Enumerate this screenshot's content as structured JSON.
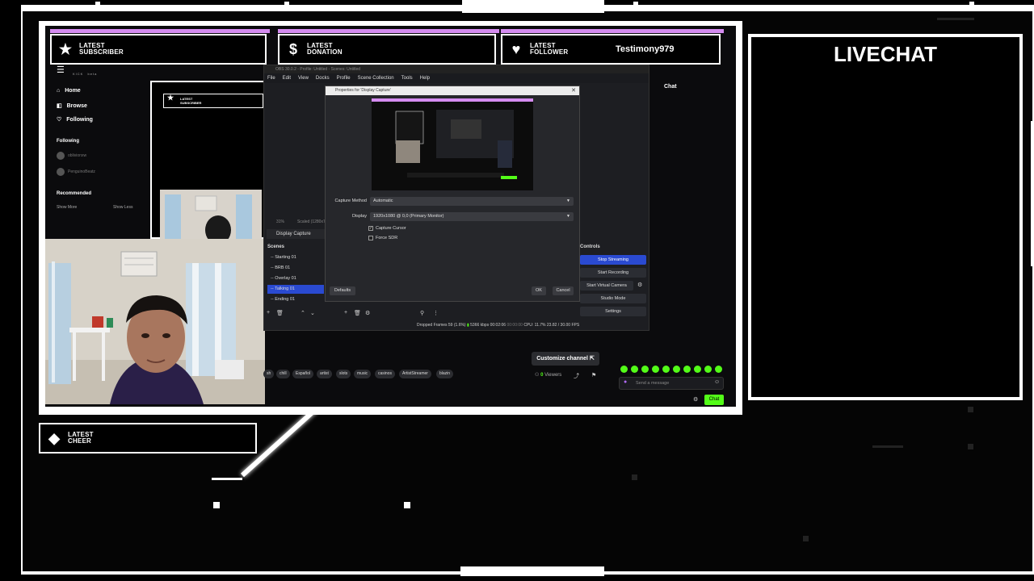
{
  "alerts": {
    "subscriber": {
      "label_line1": "LATEST",
      "label_line2": "SUBSCRIBER",
      "value": "",
      "icon": "star-icon",
      "glyph": "★"
    },
    "donation": {
      "label_line1": "LATEST",
      "label_line2": "DONATION",
      "value": "",
      "icon": "dollar-icon",
      "glyph": "$"
    },
    "follower": {
      "label_line1": "LATEST",
      "label_line2": "FOLLOWER",
      "value": "Testimony979",
      "icon": "heart-icon",
      "glyph": "♥"
    },
    "cheer": {
      "label_line1": "LATEST",
      "label_line2": "CHEER",
      "value": "",
      "icon": "diamond-icon",
      "glyph": "◆"
    }
  },
  "livechat": {
    "title": "LIVECHAT"
  },
  "kick": {
    "logo": "KICK",
    "logo_tag": "beta",
    "nav": {
      "home": "Home",
      "browse": "Browse",
      "following": "Following"
    },
    "sidebar": {
      "following_heading": "Following",
      "following_channels": [
        "oblivionxw",
        "PenguinoBeatz"
      ],
      "recommended_heading": "Recommended",
      "show_more": "Show More",
      "show_less": "Show Less"
    },
    "customize_channel": "Customize channel",
    "tags": [
      "sh",
      "chill",
      "Español",
      "artist",
      "slots",
      "music",
      "casinos",
      "ArtistStreamer",
      "blazin"
    ],
    "viewers_count": "0",
    "viewers_label": "Viewers",
    "chat_heading": "Chat",
    "chat_placeholder": "Send a message",
    "chat_button": "Chat"
  },
  "nested_preview": {
    "label_line1": "LATEST",
    "label_line2": "SUBSCRIBER"
  },
  "obs": {
    "window_title": "OBS 30.0.2 - Profile: Untitled - Scenes: Untitled",
    "menu": [
      "File",
      "Edit",
      "View",
      "Docks",
      "Profile",
      "Scene Collection",
      "Tools",
      "Help"
    ],
    "zoom": "31%",
    "scaled": "Scaled (1280x72...",
    "source": "Display Capture",
    "scenes_heading": "Scenes",
    "scenes": [
      "-- Starting 01",
      "-- BRB 01",
      "-- Overlay 01",
      "-- Talking 01",
      "-- Ending 01"
    ],
    "active_scene_index": 3,
    "controls_heading": "Controls",
    "controls": [
      "Stop Streaming",
      "Start Recording",
      "Start Virtual Camera",
      "Studio Mode",
      "Settings"
    ],
    "status": {
      "dropped_frames": "Dropped Frames 59 (1.6%)",
      "bitrate": "5366 kbps",
      "stream_time": "00:02:06",
      "rec_time": "00:00:00",
      "cpu": "CPU: 11.7%",
      "fps": "23.82 / 30.00 FPS"
    }
  },
  "dialog": {
    "title": "Properties for 'Display Capture'",
    "capture_method_label": "Capture Method",
    "capture_method_value": "Automatic",
    "display_label": "Display",
    "display_value": "1920x1080 @ 0,0 (Primary Monitor)",
    "capture_cursor": "Capture Cursor",
    "capture_cursor_checked": true,
    "force_sdr": "Force SDR",
    "force_sdr_checked": false,
    "defaults_button": "Defaults",
    "ok_button": "OK",
    "cancel_button": "Cancel"
  },
  "colors": {
    "kick_green": "#53fc18",
    "obs_blue": "#2a4ad1",
    "alert_purple": "#d58cf0"
  }
}
